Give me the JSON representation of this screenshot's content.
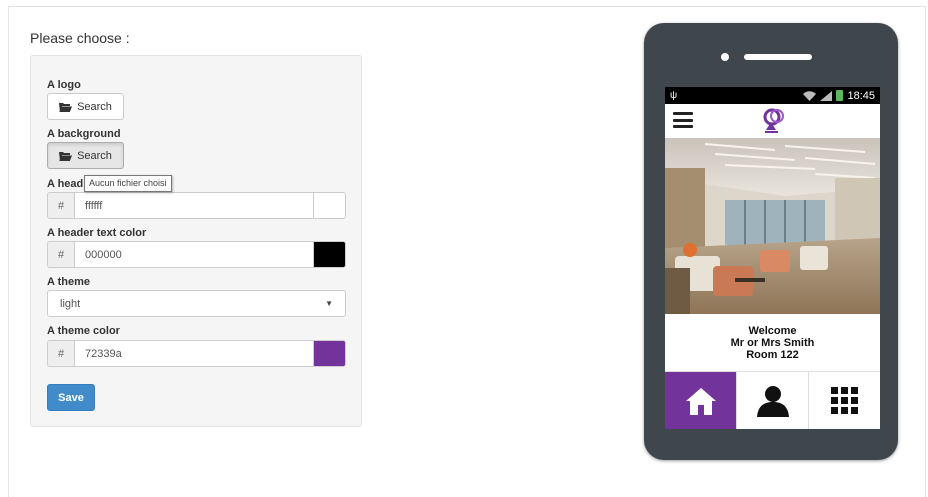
{
  "form": {
    "prompt": "Please choose :",
    "logo": {
      "label": "A logo",
      "button": "Search"
    },
    "background": {
      "label": "A background",
      "button": "Search"
    },
    "tooltip": "Aucun fichier choisi",
    "header_color": {
      "label": "A head",
      "prefix": "#",
      "value": "ffffff",
      "swatch": "#ffffff"
    },
    "header_text_color": {
      "label": "A header text color",
      "prefix": "#",
      "value": "000000",
      "swatch": "#000000"
    },
    "theme": {
      "label": "A theme",
      "value": "light"
    },
    "theme_color": {
      "label": "A theme color",
      "prefix": "#",
      "value": "72339a",
      "swatch": "#72339a"
    },
    "save_label": "Save"
  },
  "phone": {
    "status": {
      "left_icon": "usb-icon",
      "time": "18:45"
    },
    "welcome": {
      "line1": "Welcome",
      "line2": "Mr or Mrs Smith",
      "line3": "Room 122"
    },
    "tabs": [
      {
        "icon": "home-icon",
        "active": true
      },
      {
        "icon": "user-icon",
        "active": false
      },
      {
        "icon": "grid-icon",
        "active": false
      }
    ],
    "accent_color": "#72339a"
  }
}
